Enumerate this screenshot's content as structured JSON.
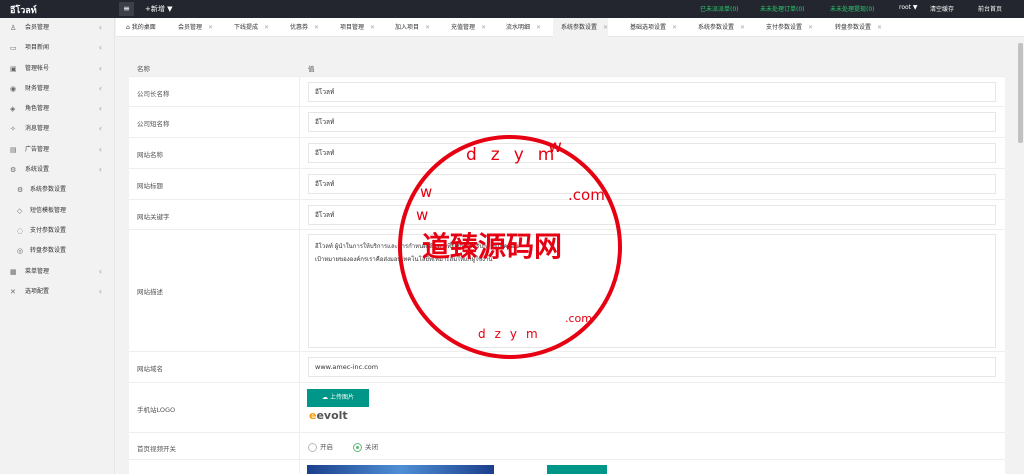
{
  "app": {
    "logo": "อีโวลท์",
    "menu_toggle": "≡",
    "new_label": "+新增 ▼"
  },
  "top_links": [
    {
      "text": "已未派派单(0)",
      "color": "green"
    },
    {
      "text": "未未处理订单(0)",
      "color": "green"
    },
    {
      "text": "未未处理提现(0)",
      "color": "green"
    },
    {
      "text": "root ▼",
      "color": "green"
    },
    {
      "text": "清空缓存",
      "color": "white"
    },
    {
      "text": "前台首页",
      "color": "white"
    }
  ],
  "sidebar": {
    "items": [
      {
        "label": "会员管理",
        "icon": "user-icon",
        "arrow": "‹"
      },
      {
        "label": "项目新闻",
        "icon": "book-icon",
        "arrow": "‹"
      },
      {
        "label": "管理帐号",
        "icon": "admin-icon",
        "arrow": "‹"
      },
      {
        "label": "财务管理",
        "icon": "finance-icon",
        "arrow": "‹"
      },
      {
        "label": "角色管理",
        "icon": "shield-icon",
        "arrow": "‹"
      },
      {
        "label": "消息管理",
        "icon": "message-icon",
        "arrow": "‹"
      },
      {
        "label": "广告管理",
        "icon": "ad-icon",
        "arrow": "‹"
      },
      {
        "label": "系统设置",
        "icon": "gear-icon",
        "arrow": "‹"
      },
      {
        "label": "系统参数设置",
        "icon": "settings-icon",
        "sub": true
      },
      {
        "label": "短信模板管理",
        "icon": "tag-icon",
        "sub": true
      },
      {
        "label": "支付参数设置",
        "icon": "dollar-icon",
        "sub": true
      },
      {
        "label": "转盘参数设置",
        "icon": "wheel-icon",
        "sub": true
      },
      {
        "label": "菜单管理",
        "icon": "menu-icon",
        "arrow": "‹"
      },
      {
        "label": "选项配置",
        "icon": "link-icon",
        "arrow": "‹"
      }
    ]
  },
  "tabs": [
    {
      "label": "⌂ 我的桌面"
    },
    {
      "label": "会员管理"
    },
    {
      "label": "下线提成"
    },
    {
      "label": "优惠券"
    },
    {
      "label": "项目管理"
    },
    {
      "label": "加入项目"
    },
    {
      "label": "充值管理"
    },
    {
      "label": "流水明细"
    },
    {
      "label": "系统参数设置",
      "active": true
    },
    {
      "label": "基础选项设置"
    },
    {
      "label": "系统参数设置"
    },
    {
      "label": "支付参数设置"
    },
    {
      "label": "转盘参数设置"
    }
  ],
  "table": {
    "header_name": "名称",
    "header_value": "值",
    "rows": [
      {
        "label": "公司长名称",
        "value": "อีโวลท์"
      },
      {
        "label": "公司短名称",
        "value": "อีโวลท์"
      },
      {
        "label": "网站名称",
        "value": "อีโวลท์"
      },
      {
        "label": "网站标题",
        "value": "อีโวลท์"
      },
      {
        "label": "网站关键字",
        "value": "อีโวลท์"
      },
      {
        "label": "网站描述",
        "value_line1": "อีโวลท์ ผู้นำในการให้บริการและการกำหนดเส้นทางที่ยั่งยืนสำหรับการขับเคลื่อน",
        "value_line2": "เป้าหมายขององค์กรเราคือส่งมอบเทคโนโลยีที่เหมาะสมให้แก่ผู้ใช้งาน"
      },
      {
        "label": "网站域名",
        "value": "www.amec-inc.com"
      },
      {
        "label": "手机站LOGO",
        "upload": "☁ 上传图片",
        "logo_text": "evolt"
      },
      {
        "label": "首页视频开关",
        "radio_on": "开启",
        "radio_off": "关闭"
      }
    ]
  },
  "watermark": {
    "center": "道臻源码网",
    "top": "dzym",
    "bottom": "dzym",
    "w1": "w",
    "w2": "w",
    "w3": "w",
    "com": ".com"
  },
  "colors": {
    "topbar": "#23262e",
    "accent_green": "#009688",
    "watermark_red": "#e60012"
  }
}
